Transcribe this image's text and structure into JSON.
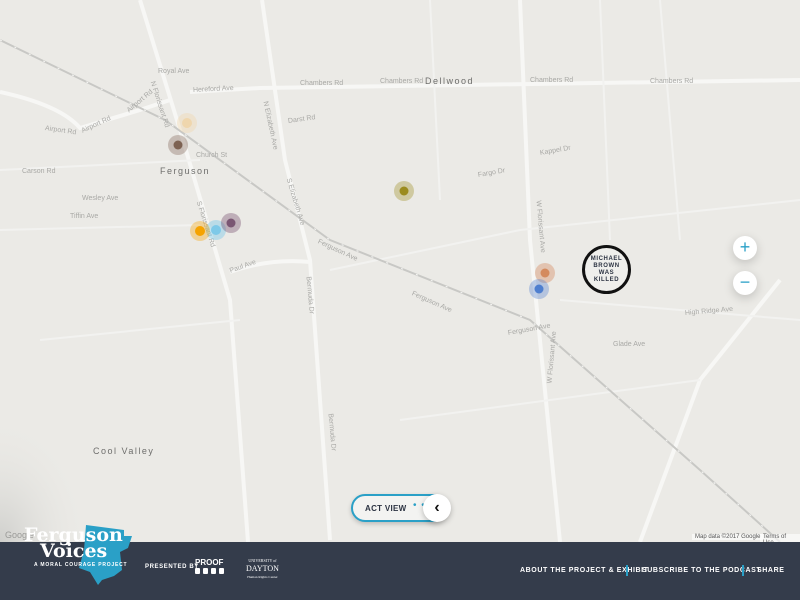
{
  "map": {
    "places": [
      "Ferguson",
      "Dellwood",
      "Cool Valley"
    ],
    "streets": [
      "Chambers Rd",
      "Chambers Rd",
      "Chambers Rd",
      "Chambers Rd",
      "Hereford Ave",
      "Airport Rd",
      "Airport Rd",
      "Airport Rd",
      "N Florissant Rd",
      "S Florissant Rd",
      "N Elizabeth Ave",
      "S Elizabeth Ave",
      "Ferguson Ave",
      "Ferguson Ave",
      "Ferguson Ave",
      "Paul Ave",
      "Bermuda Dr",
      "Bermuda Dr",
      "W Florissant Ave",
      "W Florissant Ave",
      "Carson Rd",
      "Church St",
      "Wesley Ave",
      "Tiffin Ave",
      "Kappel Dr",
      "Fargo Dr",
      "High Ridge Ave",
      "Glade Ave",
      "Royal Ave",
      "Darst Rd"
    ],
    "killed_marker": "MICHAEL BROWN WAS KILLED",
    "zoom_in": "+",
    "zoom_out": "−",
    "attribution": "Map data ©2017 Google",
    "terms": "Terms of Use",
    "google": "Google",
    "markers": [
      {
        "color": "#efd6ad"
      },
      {
        "color": "#7d6252"
      },
      {
        "color": "#f5a300"
      },
      {
        "color": "#7ec9e8"
      },
      {
        "color": "#7a5673"
      },
      {
        "color": "#9b8b1e"
      },
      {
        "color": "#d48a5e"
      },
      {
        "color": "#4f7fcf"
      }
    ]
  },
  "act_view": {
    "label": "ACT VIEW",
    "dots": "• • •",
    "icon": "‹"
  },
  "footer": {
    "logo_line1": "Ferguson",
    "logo_line2": "Voices",
    "logo_tagline": "A MORAL COURAGE PROJECT",
    "presented_by": "PRESENTED BY",
    "sponsor1": "PROOF",
    "sponsor2_line1": "UNIVERSITY of",
    "sponsor2_line2": "DAYTON",
    "sponsor2_line3": "Human Rights Center",
    "nav": [
      "ABOUT THE PROJECT & EXHIBIT",
      "SUBSCRIBE TO THE PODCAST",
      "SHARE"
    ]
  },
  "colors": {
    "accent": "#2aa0c7",
    "footer_bg": "#343c4b"
  }
}
